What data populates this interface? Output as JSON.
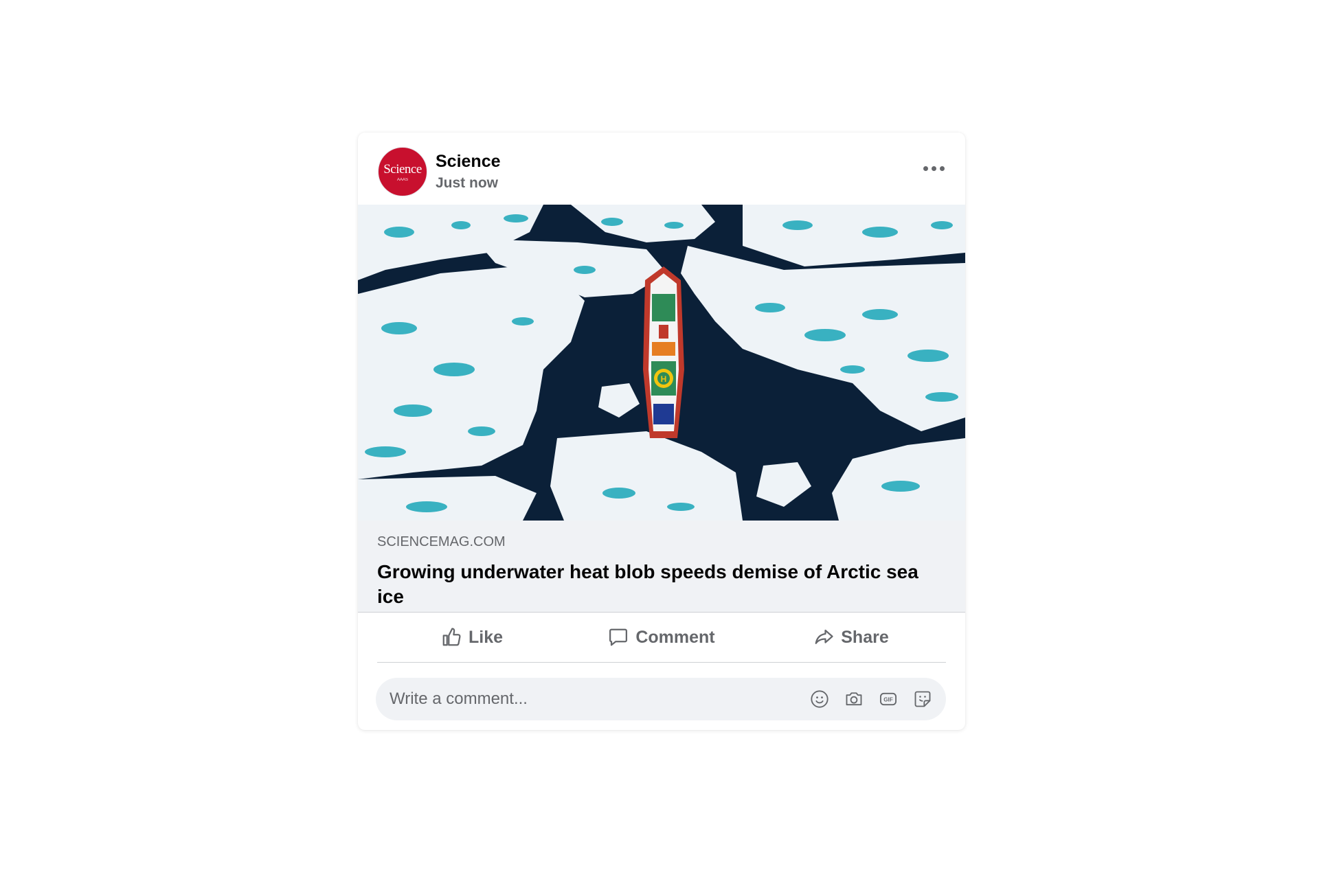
{
  "post": {
    "page_name": "Science",
    "timestamp": "Just now",
    "avatar_text": "Science",
    "avatar_subtext": "AAAS",
    "avatar_color": "#c8102e",
    "more_icon": "more-horizontal-icon",
    "image_description_icon": "arctic-icebreaker-photo"
  },
  "link_preview": {
    "domain": "SCIENCEMAG.COM",
    "title": "Growing underwater heat blob speeds demise of Arctic sea ice"
  },
  "actions": {
    "like_label": "Like",
    "comment_label": "Comment",
    "share_label": "Share"
  },
  "comment": {
    "placeholder": "Write a comment...",
    "value": "",
    "icons": [
      "emoji-icon",
      "camera-icon",
      "gif-icon",
      "sticker-icon"
    ]
  },
  "colors": {
    "primary_text": "#050505",
    "secondary_text": "#65676b",
    "surface": "#f0f2f5"
  }
}
